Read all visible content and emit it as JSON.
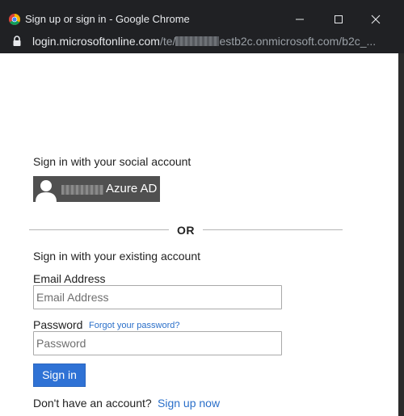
{
  "window": {
    "title": "Sign up or sign in - Google Chrome"
  },
  "address_bar": {
    "url_host": "login.microsoftonline.com",
    "url_path_start": "/te/",
    "url_path_end": "estb2c.onmicrosoft.com/b2c_..."
  },
  "social": {
    "heading": "Sign in with your social account",
    "provider_label": "Azure AD"
  },
  "divider": {
    "label": "OR"
  },
  "local": {
    "heading": "Sign in with your existing account",
    "email_label": "Email Address",
    "email_placeholder": "Email Address",
    "password_label": "Password",
    "forgot_password": "Forgot your password?",
    "password_placeholder": "Password",
    "signin_label": "Sign in"
  },
  "signup": {
    "prompt": "Don't have an account?",
    "link": "Sign up now"
  },
  "colors": {
    "titlebar": "#202124",
    "primary_button": "#2f72d5",
    "link": "#2a6fc9",
    "social_button": "#505050"
  },
  "icons": {
    "browser": "chrome-icon",
    "minimize": "minimize-icon",
    "maximize": "maximize-icon",
    "close": "close-icon",
    "secure": "lock-icon",
    "social_avatar": "user-silhouette-icon"
  }
}
